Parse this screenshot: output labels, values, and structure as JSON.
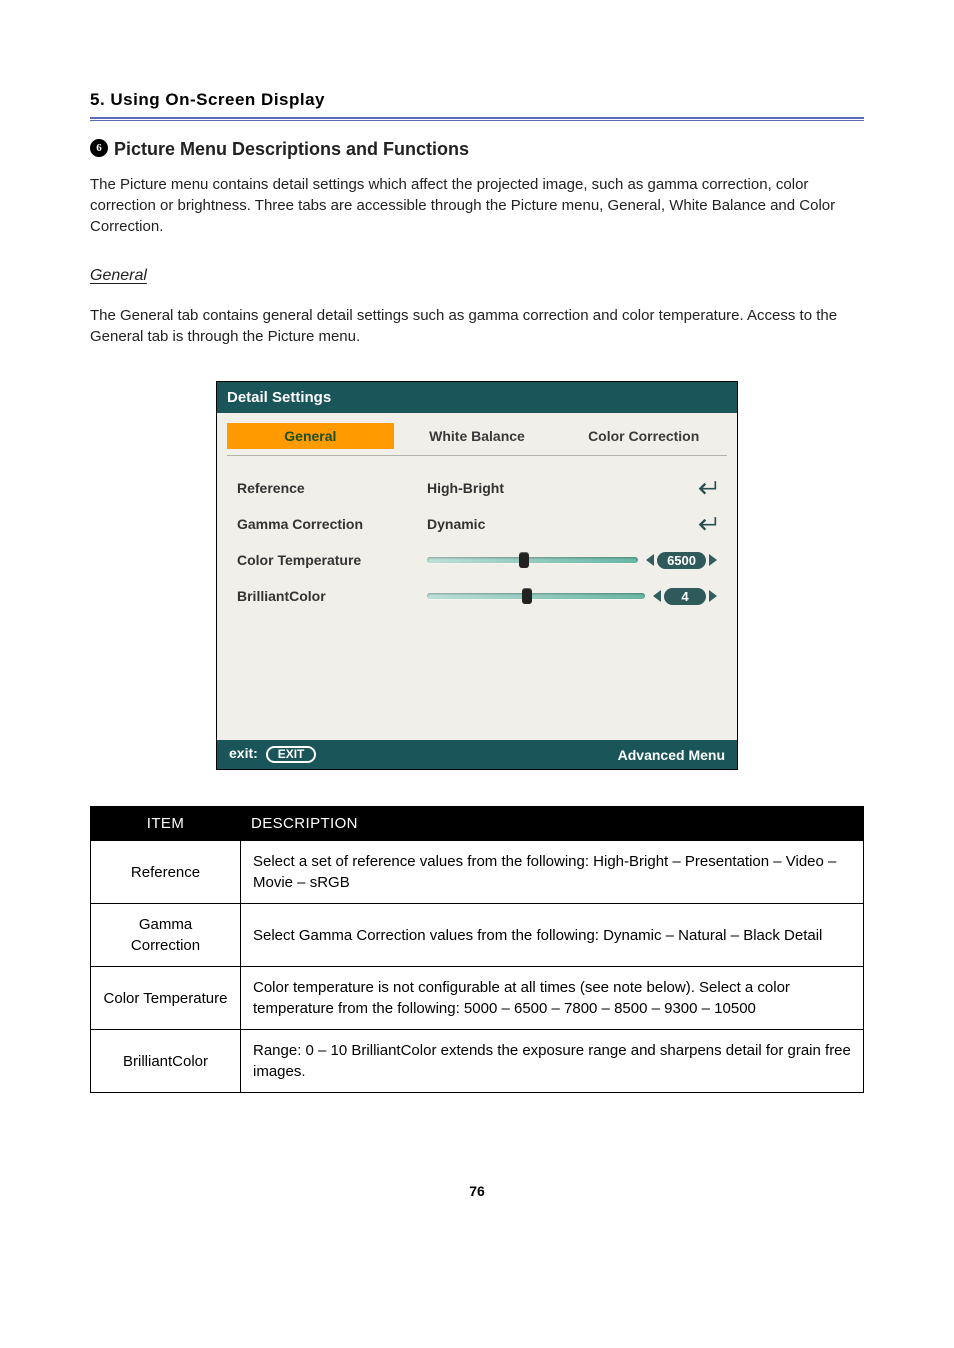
{
  "chapter_title": "5. Using On-Screen Display",
  "section_number": "6",
  "section_title": "Picture Menu Descriptions and Functions",
  "body_text": "The Picture menu contains detail settings which affect the projected image, such as gamma correction, color correction or brightness. Three tabs are accessible through the Picture menu, General, White Balance and Color Correction.",
  "subhead": "General",
  "subnote": "The General tab contains general detail settings such as gamma correction and color temperature. Access to the General tab is through the Picture menu.",
  "osd": {
    "title": "Detail Settings",
    "tabs": {
      "general": "General",
      "white_balance": "White Balance",
      "color_correction": "Color Correction"
    },
    "rows": {
      "reference_label": "Reference",
      "reference_value": "High-Bright",
      "gamma_label": "Gamma Correction",
      "gamma_value": "Dynamic",
      "ctemp_label": "Color Temperature",
      "ctemp_value": "6500",
      "ctemp_percent": 46,
      "bcolor_label": "BrilliantColor",
      "bcolor_value": "4",
      "bcolor_percent": 46
    },
    "footer_exit_label": "exit:",
    "footer_exit_button": "EXIT",
    "footer_right": "Advanced Menu"
  },
  "table": {
    "head_item": "ITEM",
    "head_desc": "DESCRIPTION",
    "rows": [
      {
        "item": "Reference",
        "desc": "Select a set of reference values from the following: High-Bright – Presentation – Video – Movie – sRGB"
      },
      {
        "item": "Gamma Correction",
        "desc": "Select Gamma Correction values from the following: Dynamic – Natural – Black Detail"
      },
      {
        "item": "Color Temperature",
        "desc": "Color temperature is not configurable at all times (see note below). Select a color temperature from the following: 5000 – 6500 – 7800 – 8500 – 9300 – 10500"
      },
      {
        "item": "BrilliantColor",
        "desc": "Range: 0 – 10 BrilliantColor extends the exposure range and sharpens detail for grain free images."
      }
    ]
  },
  "page_number": "76"
}
